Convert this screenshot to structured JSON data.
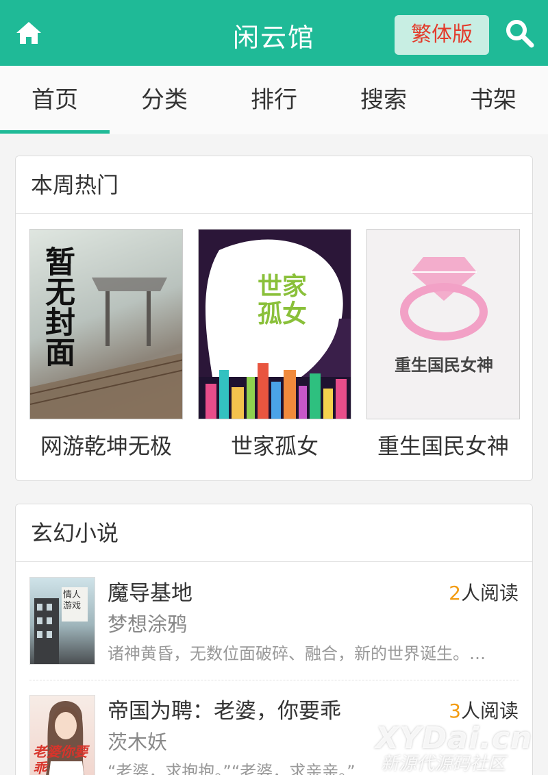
{
  "header": {
    "title": "闲云馆",
    "traditional_label": "繁体版",
    "colors": {
      "bg": "#1fba97",
      "button_bg": "#c8eee3",
      "button_text": "#e33a2a"
    },
    "icons": {
      "home": "home-icon",
      "search": "search-icon"
    }
  },
  "tabs": [
    {
      "label": "首页",
      "active": true
    },
    {
      "label": "分类"
    },
    {
      "label": "排行"
    },
    {
      "label": "搜索"
    },
    {
      "label": "书架"
    }
  ],
  "hot": {
    "heading": "本周热门",
    "books": [
      {
        "name": "网游乾坤无极",
        "cover_text": "暂无封面"
      },
      {
        "name": "世家孤女",
        "cover_text": "世家孤女"
      },
      {
        "name": "重生国民女神",
        "cover_text": "重生国民女神"
      }
    ]
  },
  "fantasy": {
    "heading": "玄幻小说",
    "reads_suffix": "人阅读",
    "items": [
      {
        "name": "魔导基地",
        "reads": "2",
        "author": "梦想涂鸦",
        "desc": "诸神黄昏，无数位面破碎、融合，新的世界诞生。…",
        "cover_text": "情人游戏"
      },
      {
        "name": "帝国为聘：老婆，你要乖",
        "reads": "3",
        "author": "茨木妖",
        "desc": "“老婆，求抱抱。”“老婆，求亲亲。”",
        "cover_text": "老婆你要乖"
      }
    ]
  },
  "watermark": {
    "line1": "XYDai.cn",
    "line2": "新源代源码社区"
  }
}
